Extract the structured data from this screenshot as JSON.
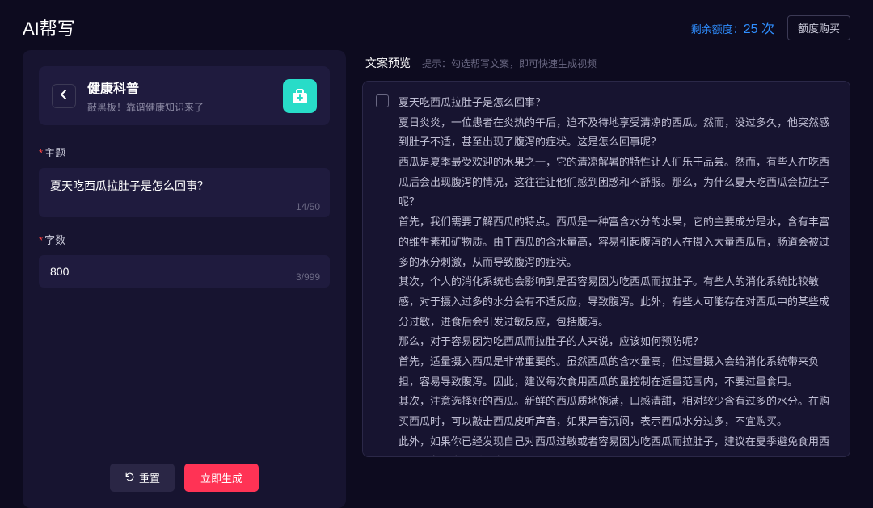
{
  "header": {
    "title": "AI帮写",
    "quota_label": "剩余额度：",
    "quota_value": "25 次",
    "buy_button": "额度购买"
  },
  "category": {
    "title": "健康科普",
    "subtitle": "敲黑板！靠谱健康知识来了"
  },
  "form": {
    "topic_label": "主题",
    "topic_value": "夏天吃西瓜拉肚子是怎么回事？",
    "topic_count": "14/50",
    "length_label": "字数",
    "length_value": "800",
    "length_count": "3/999"
  },
  "actions": {
    "reset": "重置",
    "generate": "立即生成"
  },
  "preview": {
    "title": "文案预览",
    "hint": "提示：勾选帮写文案，即可快速生成视频",
    "content": "夏天吃西瓜拉肚子是怎么回事？\n夏日炎炎，一位患者在炎热的午后，迫不及待地享受清凉的西瓜。然而，没过多久，他突然感到肚子不适，甚至出现了腹泻的症状。这是怎么回事呢？\n西瓜是夏季最受欢迎的水果之一，它的清凉解暑的特性让人们乐于品尝。然而，有些人在吃西瓜后会出现腹泻的情况，这往往让他们感到困惑和不舒服。那么，为什么夏天吃西瓜会拉肚子呢？\n首先，我们需要了解西瓜的特点。西瓜是一种富含水分的水果，它的主要成分是水，含有丰富的维生素和矿物质。由于西瓜的含水量高，容易引起腹泻的人在摄入大量西瓜后，肠道会被过多的水分刺激，从而导致腹泻的症状。\n其次，个人的消化系统也会影响到是否容易因为吃西瓜而拉肚子。有些人的消化系统比较敏感，对于摄入过多的水分会有不适反应，导致腹泻。此外，有些人可能存在对西瓜中的某些成分过敏，进食后会引发过敏反应，包括腹泻。\n那么，对于容易因为吃西瓜而拉肚子的人来说，应该如何预防呢？\n首先，适量摄入西瓜是非常重要的。虽然西瓜的含水量高，但过量摄入会给消化系统带来负担，容易导致腹泻。因此，建议每次食用西瓜的量控制在适量范围内，不要过量食用。\n其次，注意选择好的西瓜。新鲜的西瓜质地饱满，口感清甜，相对较少含有过多的水分。在购买西瓜时，可以敲击西瓜皮听声音，如果声音沉闷，表示西瓜水分过多，不宜购买。\n此外，如果你已经发现自己对西瓜过敏或者容易因为吃西瓜而拉肚子，建议在夏季避免食用西瓜，以免引发不适反应。\n总结起来，夏天吃西瓜拉肚子的原因主要是因为西瓜的高水分含量和个人消化系统的敏感性。为了避免腹泻的发生，我们应该适量摄入西瓜，选择好的西瓜，并且对于容易因为吃西瓜而拉肚子的人来说，最好避免食用西瓜。让我们在夏天享受西瓜的同时，也要注意自己的身体健康。"
  }
}
